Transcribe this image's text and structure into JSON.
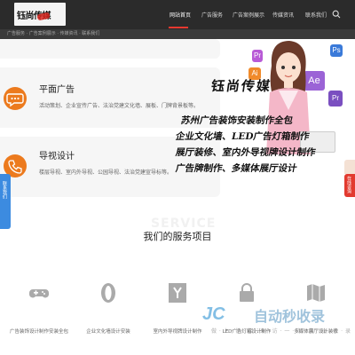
{
  "header": {
    "logo_text": "钰尚传媒",
    "nav": [
      {
        "label": "网站首页",
        "active": true
      },
      {
        "label": "广告服务",
        "active": false
      },
      {
        "label": "广告案例展示",
        "active": false
      },
      {
        "label": "传媒资讯",
        "active": false
      },
      {
        "label": "联系我们",
        "active": false
      }
    ]
  },
  "breadcrumb": "广告服务 · 广告案例展示 · 传媒资讯 · 联系我们",
  "cards": [
    {
      "title": "平面广告",
      "desc": "活动策划、企业宣传广告、法治党建文化墙、展板、门牌背景板等。"
    },
    {
      "title": "导视设计",
      "desc": "楼层导视、室内外导视、公园导视、法治党建宣导标等。"
    }
  ],
  "promo": {
    "brand": "钰尚传媒",
    "lines": [
      "苏州广告装饰安装制作全包",
      "企业文化墙、LED广告灯箱制作",
      "展厅装修、室内外导视牌设计制作",
      "广告牌制作、多媒体展厅设计"
    ],
    "app_icons": [
      "Pr",
      "Ai",
      "Ps",
      "Ae",
      "Pr"
    ]
  },
  "side_tabs": {
    "left": "联系我们",
    "right": "在线咨询"
  },
  "services": {
    "watermark": "SERVICE",
    "title": "我们的服务项目",
    "items": [
      {
        "label": "广告装饰设计制作安装全包",
        "icon": "gamepad-icon"
      },
      {
        "label": "企业文化墙设计安装",
        "icon": "opera-icon"
      },
      {
        "label": "室内外导视牌设计制作",
        "icon": "y-combinator-icon"
      },
      {
        "label": "LED广告灯箱设计制作",
        "icon": "lock-icon"
      },
      {
        "label": "多媒体展厅设计装修",
        "icon": "map-icon"
      }
    ]
  },
  "overlay": {
    "logo": "JC",
    "text": "自动秒收录",
    "sub": "做 · 上 · 链 · 接 · 来 · 访 · 一 · 次 · 自 · 动 · 收 · 录"
  },
  "colors": {
    "header_bg": "#2b2b2b",
    "accent": "#e8382f",
    "icon_orange": "#ec7a1d",
    "side_blue": "#3c8be0"
  }
}
